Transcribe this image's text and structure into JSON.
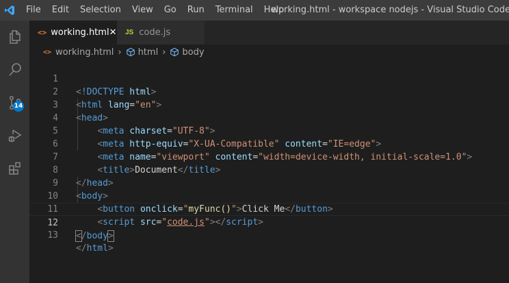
{
  "window": {
    "title": "working.html - workspace nodejs - Visual Studio Code"
  },
  "menu": [
    "File",
    "Edit",
    "Selection",
    "View",
    "Go",
    "Run",
    "Terminal",
    "Help"
  ],
  "activity_bar": {
    "items": [
      "explorer-icon",
      "search-icon",
      "source-control-icon",
      "run-debug-icon",
      "extensions-icon"
    ],
    "source_control_badge": "14"
  },
  "tabs": [
    {
      "label": "working.html",
      "icon": "<>",
      "active": true,
      "close": "✕"
    },
    {
      "label": "code.js",
      "icon": "JS",
      "active": false
    }
  ],
  "breadcrumb": {
    "file": "working.html",
    "file_icon": "<>",
    "items": [
      "html",
      "body"
    ]
  },
  "editor": {
    "current_line": 12,
    "lines": [
      {
        "n": "1"
      },
      {
        "n": "2"
      },
      {
        "n": "3"
      },
      {
        "n": "4"
      },
      {
        "n": "5"
      },
      {
        "n": "6"
      },
      {
        "n": "7"
      },
      {
        "n": "8"
      },
      {
        "n": "9"
      },
      {
        "n": "10"
      },
      {
        "n": "11"
      },
      {
        "n": "12"
      },
      {
        "n": "13"
      }
    ],
    "code": {
      "doctype": "!DOCTYPE",
      "html_kw": "html",
      "lang_attr": "lang",
      "lang_val": "\"en\"",
      "head_kw": "head",
      "meta_kw": "meta",
      "charset_attr": "charset",
      "charset_val": "\"UTF-8\"",
      "http_equiv_attr": "http-equiv",
      "http_equiv_val": "\"X-UA-Compatible\"",
      "content_attr": "content",
      "content1_val": "\"IE=edge\"",
      "name_attr": "name",
      "name_val": "\"viewport\"",
      "content2_val": "\"width=device-width, initial-scale=1.0\"",
      "title_kw": "title",
      "title_text": "Document",
      "body_kw": "body",
      "button_kw": "button",
      "onclick_attr": "onclick",
      "onclick_q1": "\"",
      "onclick_fn": "myFunc()",
      "onclick_q2": "\"",
      "button_text": "Click Me",
      "script_kw": "script",
      "src_attr": "src",
      "src_val": "code.js"
    }
  }
}
